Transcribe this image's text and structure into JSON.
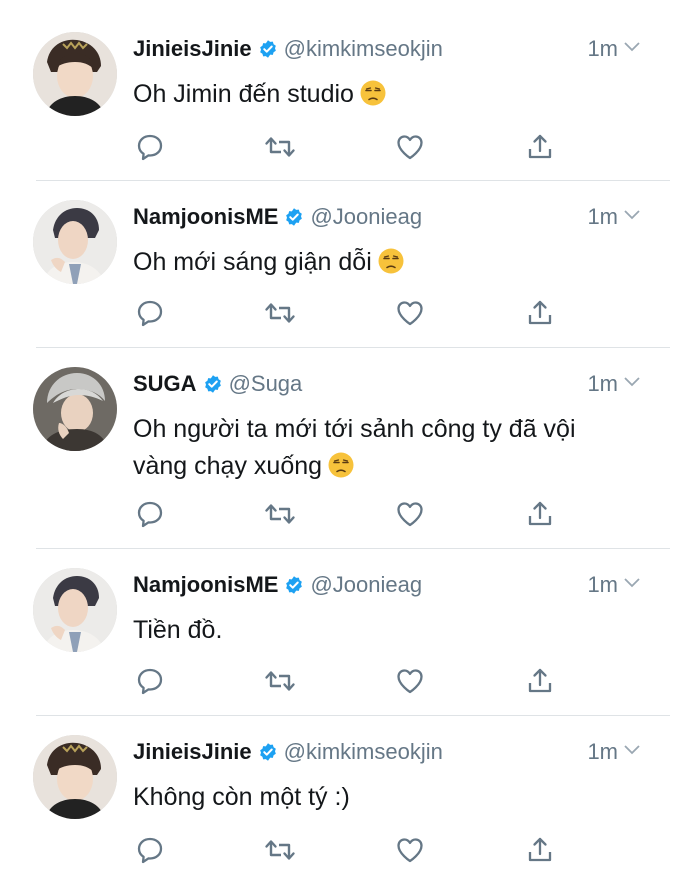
{
  "icons": [
    "reply-icon",
    "retweet-icon",
    "like-icon",
    "share-icon",
    "verified-icon",
    "chevron-down-icon",
    "unamused-face-emoji"
  ],
  "colors": {
    "name": "#14171a",
    "muted": "#657786",
    "verified": "#1da1f2",
    "icon": "#657786",
    "divider": "#dfe3e6"
  },
  "tweets": [
    {
      "name": "JinieisJinie",
      "handle": "@kimkimseokjin",
      "time": "1m",
      "text": "Oh Jimin đến studio",
      "emoji": true
    },
    {
      "name": "NamjoonisME",
      "handle": "@Joonieag",
      "time": "1m",
      "text": "Oh mới sáng giận dỗi",
      "emoji": true
    },
    {
      "name": "SUGA",
      "handle": "@Suga",
      "time": "1m",
      "text_line1": "Oh người ta mới tới sảnh công ty đã vội",
      "text_line2": "vàng chạy xuống",
      "emoji": true
    },
    {
      "name": "NamjoonisME",
      "handle": "@Joonieag",
      "time": "1m",
      "text": "Tiền đồ.",
      "emoji": false
    },
    {
      "name": "JinieisJinie",
      "handle": "@kimkimseokjin",
      "time": "1m",
      "text": "Không còn một tý :)",
      "emoji": false
    }
  ]
}
